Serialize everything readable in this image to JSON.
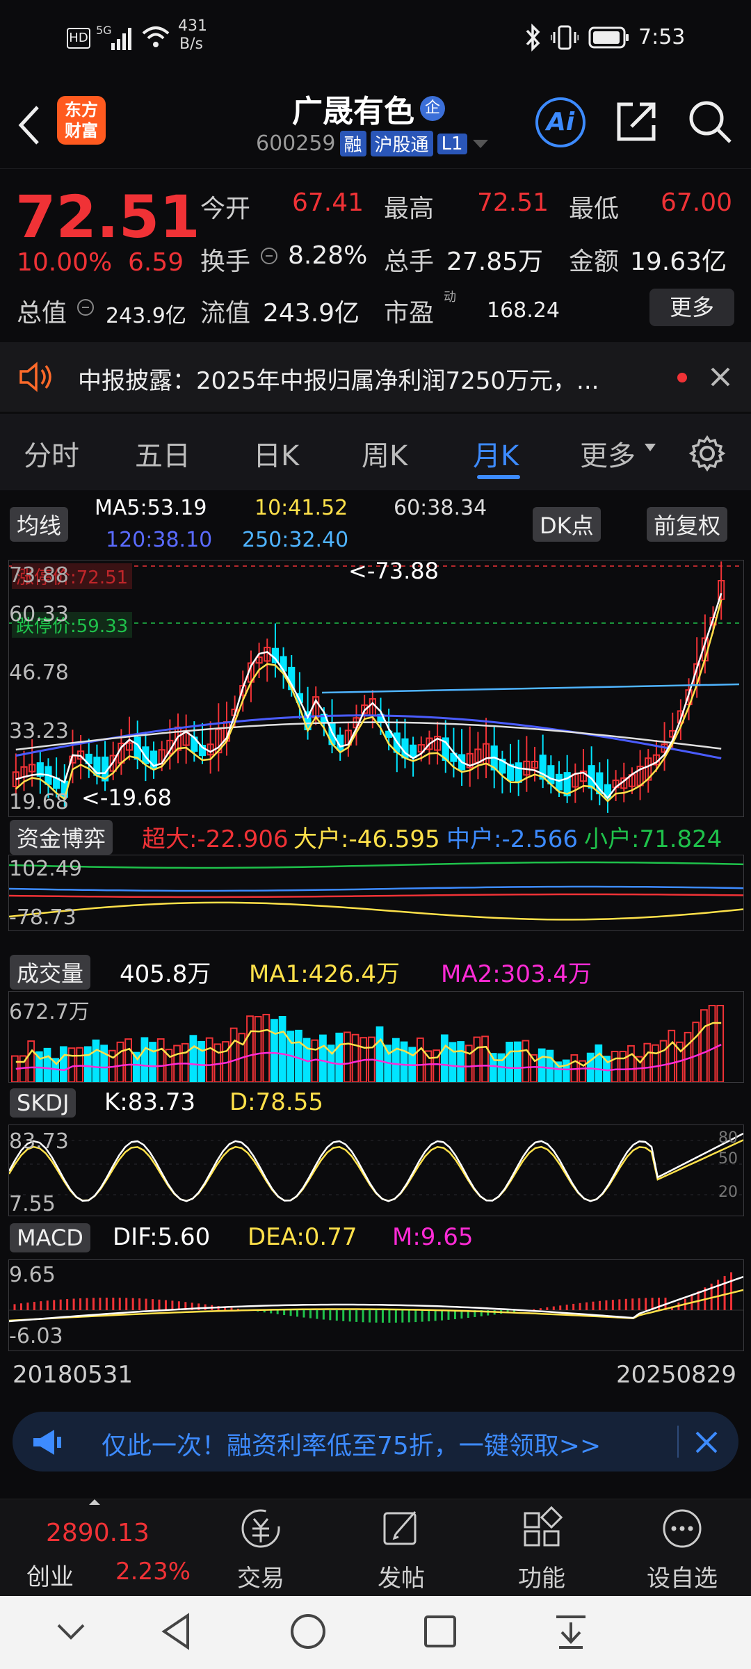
{
  "status_bar": {
    "time": "7:53",
    "net_speed_value": "431",
    "net_speed_unit": "B/s",
    "hd_label": "HD",
    "signal_label": "5G"
  },
  "header": {
    "logo_text": "东方\n财富",
    "stock_name": "广晟有色",
    "name_badge": "企",
    "code": "600259",
    "tags": [
      "融",
      "沪股通",
      "L1"
    ],
    "ai_label": "Ai"
  },
  "quote": {
    "price": "72.51",
    "change_pct": "10.00%",
    "change": "6.59",
    "open_label": "今开",
    "open": "67.41",
    "high_label": "最高",
    "high": "72.51",
    "low_label": "最低",
    "low": "67.00",
    "turnover_label": "换手",
    "turnover": "8.28%",
    "volume_label": "总手",
    "volume": "27.85万",
    "amount_label": "金额",
    "amount": "19.63亿",
    "total_mv_label": "总值",
    "total_mv": "243.9亿",
    "float_mv_label": "流值",
    "float_mv": "243.9亿",
    "pe_label": "市盈",
    "pe_sup": "动",
    "pe": "168.24",
    "more_button": "更多"
  },
  "notice": {
    "text": "中报披露：2025年中报归属净利润7250万元，..."
  },
  "tabs": [
    {
      "label": "分时"
    },
    {
      "label": "五日"
    },
    {
      "label": "日K"
    },
    {
      "label": "周K"
    },
    {
      "label": "月K"
    },
    {
      "label": "更多"
    }
  ],
  "active_tab": "月K",
  "ma_bar": {
    "chip": "均线",
    "ma5": "MA5:53.19",
    "ma10": "10:41.52",
    "ma60": "60:38.34",
    "ma120": "120:38.10",
    "ma250": "250:32.40",
    "dk_button": "DK点",
    "adjust_button": "前复权"
  },
  "kline": {
    "limit_up_label": "涨停价:72.51",
    "limit_down_label": "跌停价:59.33",
    "axis_labels": [
      "73.88",
      "60.33",
      "46.78",
      "33.23",
      "19.68"
    ],
    "max_marker": "<-73.88",
    "min_marker": "<-19.68"
  },
  "fund_flow": {
    "chip": "资金博弈",
    "super": "超大:-22.906",
    "large": "大户:-46.595",
    "mid": "中户:-2.566",
    "small": "小户:71.824",
    "axis_top": "102.49",
    "axis_bottom": "-78.73"
  },
  "volume_panel": {
    "chip": "成交量",
    "current": "405.8万",
    "ma1": "MA1:426.4万",
    "ma2": "MA2:303.4万",
    "axis_top": "672.7万"
  },
  "skdj": {
    "chip": "SKDJ",
    "k": "K:83.73",
    "d": "D:78.55",
    "axis_top": "83.73",
    "axis_bottom": "7.55",
    "ref_lines": [
      "80",
      "50",
      "20"
    ]
  },
  "macd": {
    "chip": "MACD",
    "dif": "DIF:5.60",
    "dea": "DEA:0.77",
    "m": "M:9.65",
    "axis_top": "9.65",
    "axis_bottom": "-6.03"
  },
  "dates": {
    "start": "20180531",
    "end": "20250829"
  },
  "ad": {
    "text": "仅此一次！融资利率低至75折，一键领取>>"
  },
  "toolbar": {
    "index_value": "2890.13",
    "index_name": "创业",
    "index_change": "2.23%",
    "items": [
      {
        "label": "交易"
      },
      {
        "label": "发帖"
      },
      {
        "label": "功能"
      },
      {
        "label": "设自选"
      }
    ]
  },
  "colors": {
    "up": "#f03236",
    "down": "#1fc24b",
    "accent": "#3d8bff",
    "ma5": "#ffffff",
    "ma10": "#ffe14a",
    "ma60": "#e0e0e0",
    "ma120": "#4a5cff",
    "ma250": "#4fb4ff",
    "cyan_bar": "#00e5ff",
    "magenta": "#ff2bd6"
  }
}
